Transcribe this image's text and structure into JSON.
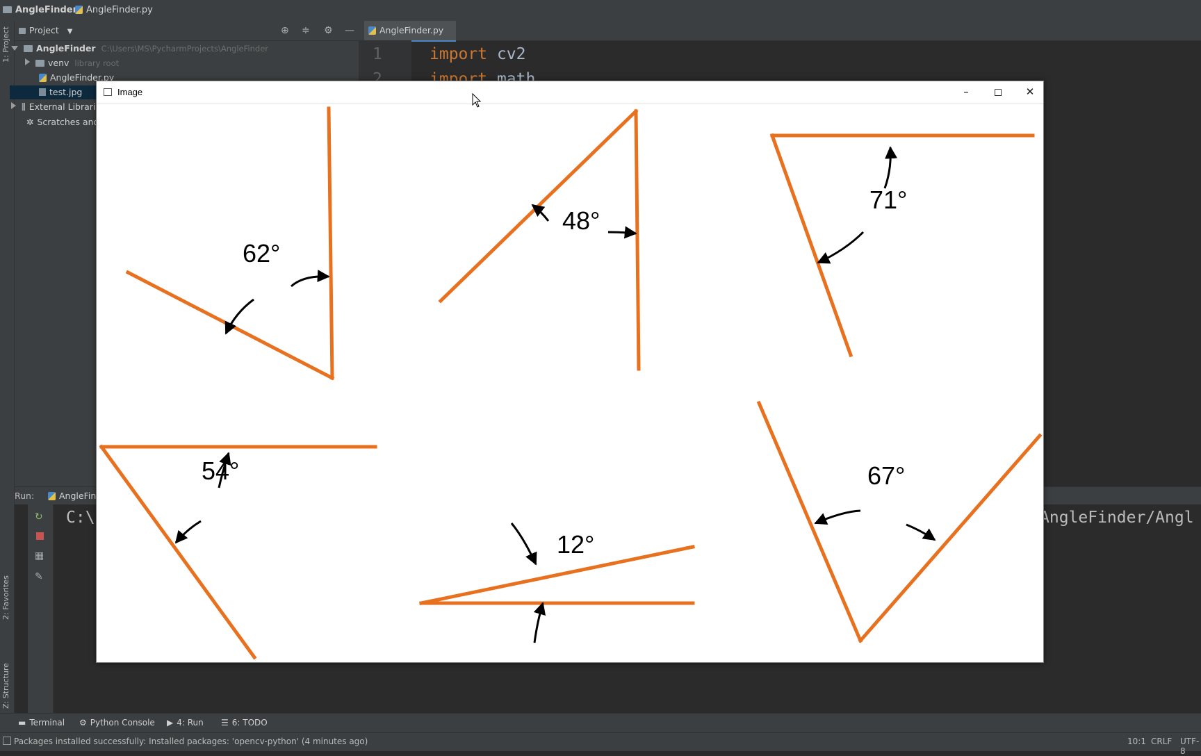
{
  "titlebar": {
    "project": "AngleFinder",
    "file": "AngleFinder.py"
  },
  "leftstrip": {
    "project_label": "1: Project",
    "favorites_label": "2: Favorites",
    "structure_label": "Z: Structure"
  },
  "project_panel": {
    "header": "Project",
    "root": {
      "name": "AngleFinder",
      "path": "C:\\Users\\MS\\PycharmProjects\\AngleFinder"
    },
    "items": [
      {
        "name": "venv",
        "hint": "library root"
      },
      {
        "name": "AngleFinder.py"
      },
      {
        "name": "test.jpg"
      },
      {
        "name": "External Libraries"
      },
      {
        "name": "Scratches and Consoles"
      }
    ]
  },
  "editor": {
    "tab": "AngleFinder.py",
    "lines": [
      {
        "num": "1",
        "kw": "import",
        "rest": " cv2"
      },
      {
        "num": "2",
        "kw": "import",
        "rest": " math"
      }
    ]
  },
  "run_panel": {
    "label": "Run:",
    "tab": "AngleFinder",
    "output_left": "C:\\",
    "output_right": "AngleFinder/Angl"
  },
  "image_window": {
    "title": "Image",
    "angles": [
      {
        "label": "62°",
        "value_deg": 62
      },
      {
        "label": "48°",
        "value_deg": 48
      },
      {
        "label": "71°",
        "value_deg": 71
      },
      {
        "label": "54°",
        "value_deg": 54
      },
      {
        "label": "12°",
        "value_deg": 12
      },
      {
        "label": "67°",
        "value_deg": 67
      }
    ],
    "line_color": "#e8711f"
  },
  "bottom_tabs": [
    "Terminal",
    "Python Console",
    "4: Run",
    "6: TODO"
  ],
  "status": {
    "message": "Packages installed successfully: Installed packages: 'opencv-python' (4 minutes ago)",
    "position": "10:1",
    "line_sep": "CRLF",
    "encoding": "UTF-8"
  },
  "colors": {
    "accent": "#4a88c7",
    "keyword": "#cc7832",
    "ide_bg": "#2b2b2b",
    "panel_bg": "#3c3f41"
  }
}
